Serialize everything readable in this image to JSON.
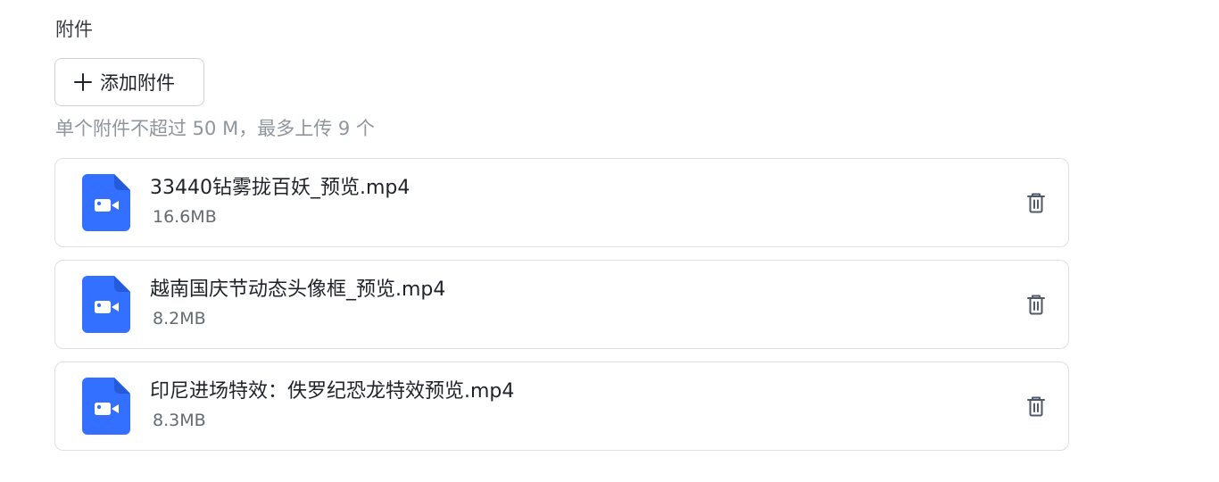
{
  "attachments": {
    "title": "附件",
    "add_label": "添加附件",
    "hint": "单个附件不超过 50 M，最多上传 9 个",
    "accent_color": "#3370ff",
    "files": [
      {
        "name": "33440钻雾拢百妖_预览.mp4",
        "size": "16.6MB",
        "icon": "video-file-icon"
      },
      {
        "name": "越南国庆节动态头像框_预览.mp4",
        "size": "8.2MB",
        "icon": "video-file-icon"
      },
      {
        "name": "印尼进场特效：佚罗纪恐龙特效预览.mp4",
        "size": "8.3MB",
        "icon": "video-file-icon"
      }
    ]
  }
}
